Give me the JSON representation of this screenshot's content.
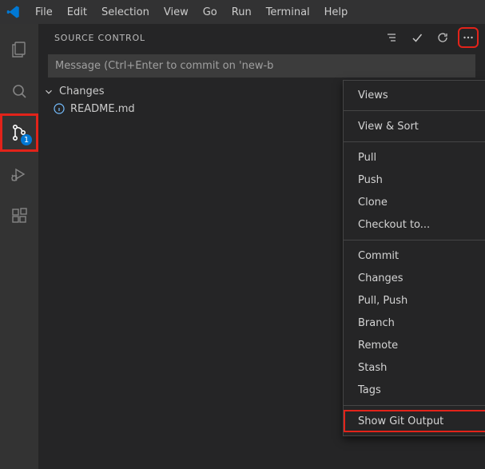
{
  "menubar": {
    "items": [
      "File",
      "Edit",
      "Selection",
      "View",
      "Go",
      "Run",
      "Terminal",
      "Help"
    ]
  },
  "activitybar": {
    "scm_badge": "1"
  },
  "panel": {
    "title": "SOURCE CONTROL",
    "commit_placeholder": "Message (Ctrl+Enter to commit on 'new-b",
    "changes_label": "Changes",
    "file": "README.md"
  },
  "context_menu": {
    "views": "Views",
    "view_sort": "View & Sort",
    "pull": "Pull",
    "push": "Push",
    "clone": "Clone",
    "checkout": "Checkout to...",
    "commit": "Commit",
    "changes": "Changes",
    "pull_push": "Pull, Push",
    "branch": "Branch",
    "remote": "Remote",
    "stash": "Stash",
    "tags": "Tags",
    "show_git_output": "Show Git Output"
  }
}
